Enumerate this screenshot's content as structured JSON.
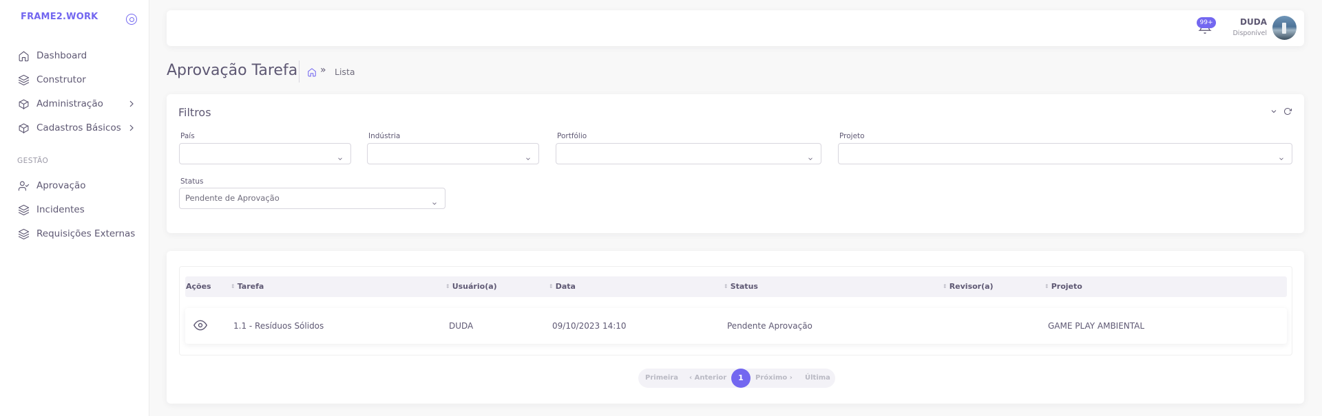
{
  "app": {
    "brand": "FRAME2.WORK"
  },
  "sidebar": {
    "items": [
      {
        "label": "Dashboard",
        "icon": "home-icon"
      },
      {
        "label": "Construtor",
        "icon": "layers-icon"
      },
      {
        "label": "Administração",
        "icon": "package-icon",
        "has_children": true
      },
      {
        "label": "Cadastros Básicos",
        "icon": "package-icon",
        "has_children": true
      }
    ],
    "section_title": "GESTÃO",
    "section_items": [
      {
        "label": "Aprovação",
        "icon": "user-check-icon"
      },
      {
        "label": "Incidentes",
        "icon": "layers-icon"
      },
      {
        "label": "Requisições Externas",
        "icon": "layers-icon"
      }
    ]
  },
  "header": {
    "notifications_badge": "99+",
    "user_name": "DUDA",
    "user_status": "Disponível"
  },
  "page": {
    "title": "Aprovação Tarefa",
    "breadcrumb_current": "Lista",
    "breadcrumb_separator": "»"
  },
  "filters": {
    "title": "Filtros",
    "fields": {
      "pais": {
        "label": "País",
        "value": ""
      },
      "industria": {
        "label": "Indústria",
        "value": ""
      },
      "portfolio": {
        "label": "Portfólio",
        "value": ""
      },
      "projeto": {
        "label": "Projeto",
        "value": ""
      },
      "status": {
        "label": "Status",
        "value": "Pendente de Aprovação"
      }
    }
  },
  "table": {
    "columns": [
      "Ações",
      "Tarefa",
      "Usuário(a)",
      "Data",
      "Status",
      "Revisor(a)",
      "Projeto"
    ],
    "rows": [
      {
        "tarefa": "1.1 - Resíduos Sólidos",
        "usuario": "DUDA",
        "data": "09/10/2023 14:10",
        "status": "Pendente Aprovação",
        "revisor": "",
        "projeto": "GAME PLAY AMBIENTAL"
      }
    ]
  },
  "pagination": {
    "first": "Primeira",
    "prev": "‹ Anterior",
    "current": "1",
    "next": "Próximo ›",
    "last": "Última"
  },
  "colors": {
    "accent": "#7367f0",
    "text": "#5e5873",
    "background": "#f8f8f8"
  }
}
